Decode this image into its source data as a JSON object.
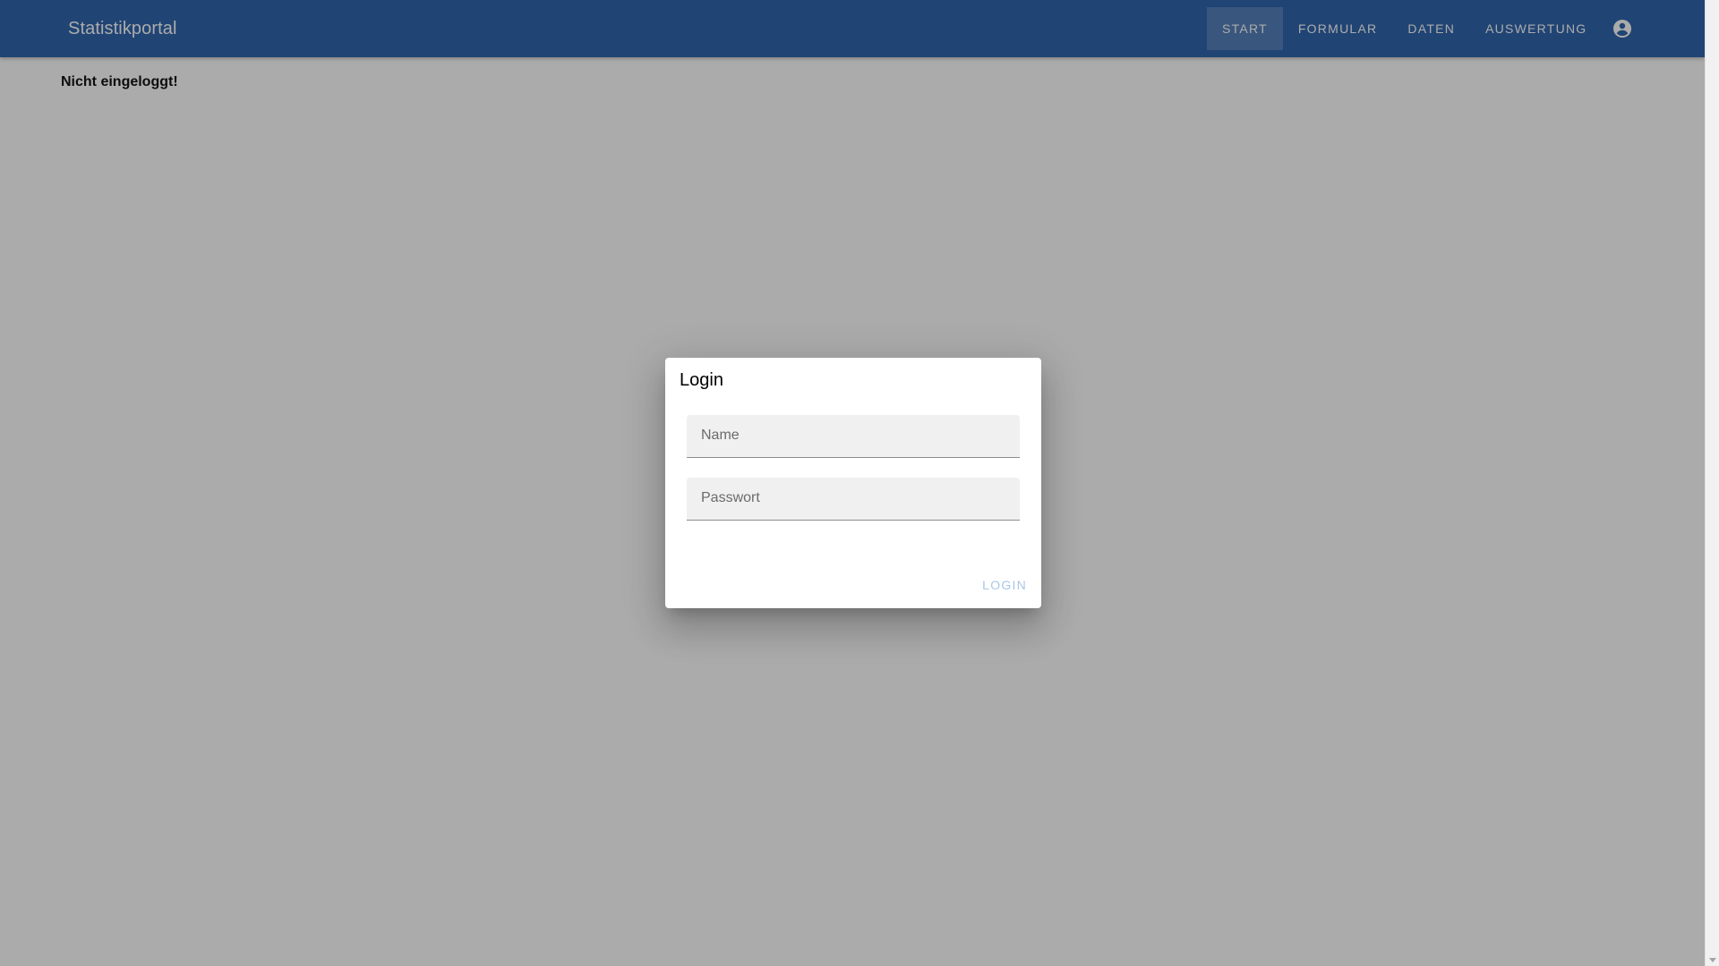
{
  "app": {
    "title": "Statistikportal"
  },
  "nav": {
    "items": [
      {
        "label": "START",
        "active": true
      },
      {
        "label": "FORMULAR",
        "active": false
      },
      {
        "label": "DATEN",
        "active": false
      },
      {
        "label": "AUSWERTUNG",
        "active": false
      }
    ],
    "account_icon": "account-circle-icon"
  },
  "main": {
    "status": "Nicht eingeloggt!"
  },
  "dialog": {
    "title": "Login",
    "name_label": "Name",
    "password_label": "Passwort",
    "login_label": "LOGIN"
  },
  "colors": {
    "app_bar": "#1f5aa6",
    "login_button_disabled": "#a9c6ea",
    "overlay": "rgba(33,33,33,0.38)"
  }
}
